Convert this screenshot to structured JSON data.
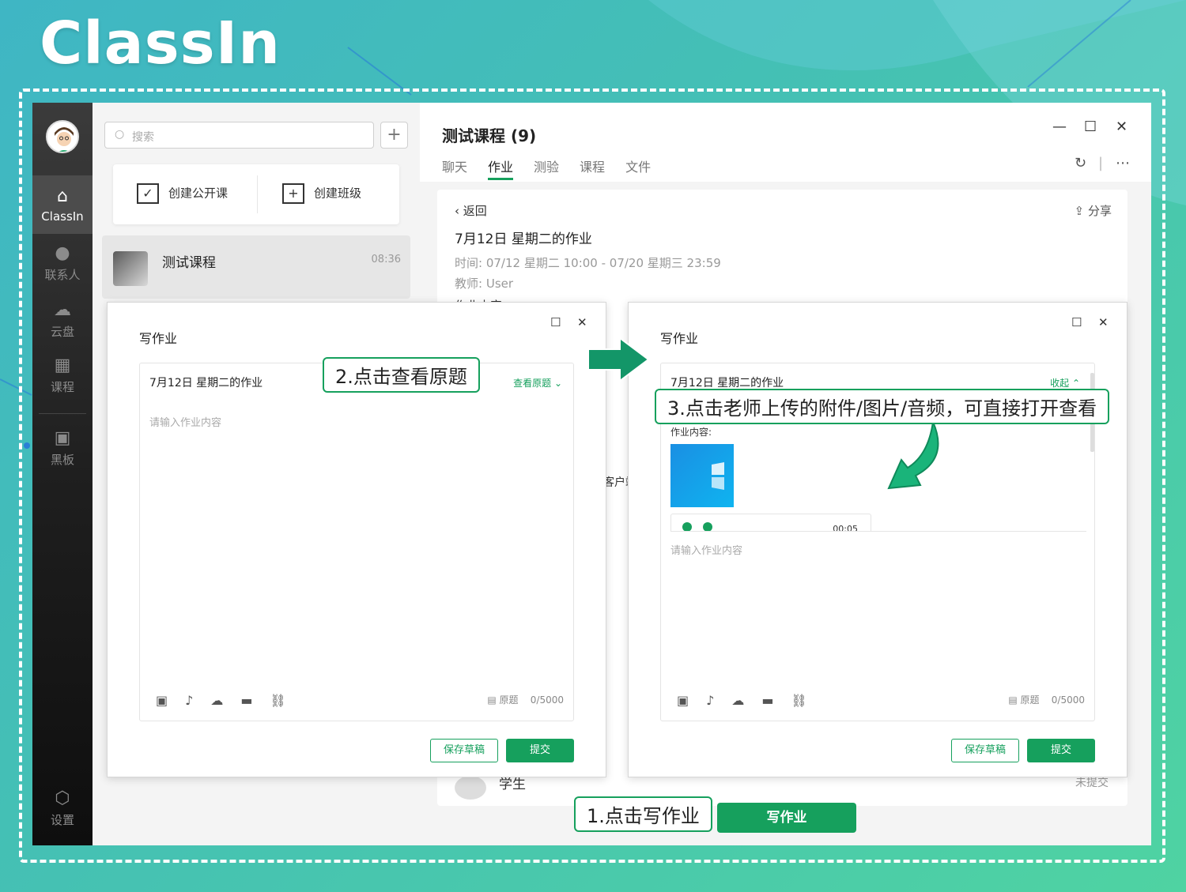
{
  "brand": {
    "logo": "ClassIn",
    "accent": "#16a05d"
  },
  "sidebar": {
    "items": [
      {
        "label": "ClassIn",
        "icon": "home-icon"
      },
      {
        "label": "联系人",
        "icon": "user-icon"
      },
      {
        "label": "云盘",
        "icon": "cloud-icon"
      },
      {
        "label": "课程",
        "icon": "calendar-icon"
      },
      {
        "label": "黑板",
        "icon": "blackboard-icon"
      },
      {
        "label": "设置",
        "icon": "settings-icon"
      }
    ]
  },
  "middle": {
    "search_placeholder": "搜索",
    "create_public": "创建公开课",
    "create_class": "创建班级",
    "course": {
      "name": "测试课程",
      "time": "08:36"
    }
  },
  "panel": {
    "course_title": "测试课程 (9)",
    "tabs": [
      {
        "label": "聊天"
      },
      {
        "label": "作业"
      },
      {
        "label": "测验"
      },
      {
        "label": "课程"
      },
      {
        "label": "文件"
      }
    ],
    "back": "返回",
    "share": "分享",
    "hw_title": "7月12日 星期二的作业",
    "time_label": "时间:",
    "time_value": "07/12 星期二 10:00 - 07/20 星期三 23:59",
    "teacher_label": "教师:",
    "teacher_value": "User",
    "content_peek": "作业内容",
    "peek_client": "客户端",
    "student_peek": "学生",
    "status_peek": "未提交",
    "write_button": "写作业"
  },
  "dialog_left": {
    "title": "写作业",
    "hw_title": "7月12日 星期二的作业",
    "view_original": "查看原题",
    "placeholder": "请输入作业内容",
    "original_label": "原题",
    "counter": "0/5000",
    "save_draft": "保存草稿",
    "submit": "提交"
  },
  "dialog_right": {
    "title": "写作业",
    "hw_title": "7月12日 星期二的作业",
    "collapse": "收起",
    "content_label": "作业内容:",
    "audio_time": "00:05",
    "placeholder": "请输入作业内容",
    "original_label": "原题",
    "counter": "0/5000",
    "save_draft": "保存草稿",
    "submit": "提交"
  },
  "callouts": {
    "step1": "1.点击写作业",
    "step2": "2.点击查看原题",
    "step3": "3.点击老师上传的附件/图片/音频，可直接打开查看"
  }
}
